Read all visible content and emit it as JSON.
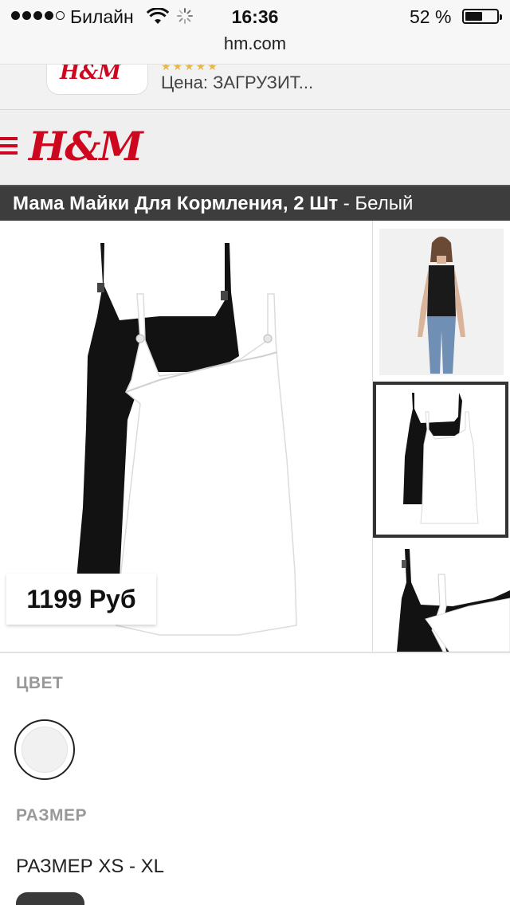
{
  "status_bar": {
    "carrier": "Билайн",
    "time": "16:36",
    "battery_percent": "52 %",
    "signal_bars_filled": 4,
    "signal_bars_total": 5,
    "battery_level": 0.52
  },
  "browser": {
    "url": "hm.com"
  },
  "app_banner": {
    "price_text": "Цена: ЗАГРУЗИТ..."
  },
  "header": {
    "logo_text": "H&M",
    "brand_color": "#cc071e"
  },
  "product": {
    "title": "Мама Майки Для Кормления, 2 Шт",
    "title_separator": " - ",
    "color_name": "Белый",
    "price": "1199 Руб"
  },
  "gallery": {
    "thumbnails": [
      "model-photo",
      "product-pair-photo",
      "product-detail-photo"
    ],
    "selected_thumbnail": 1
  },
  "options": {
    "color_label": "ЦВЕТ",
    "size_label": "РАЗМЕР",
    "size_range": "РАЗМЕР XS - XL",
    "selected_swatch_color": "#f1f1f1"
  }
}
